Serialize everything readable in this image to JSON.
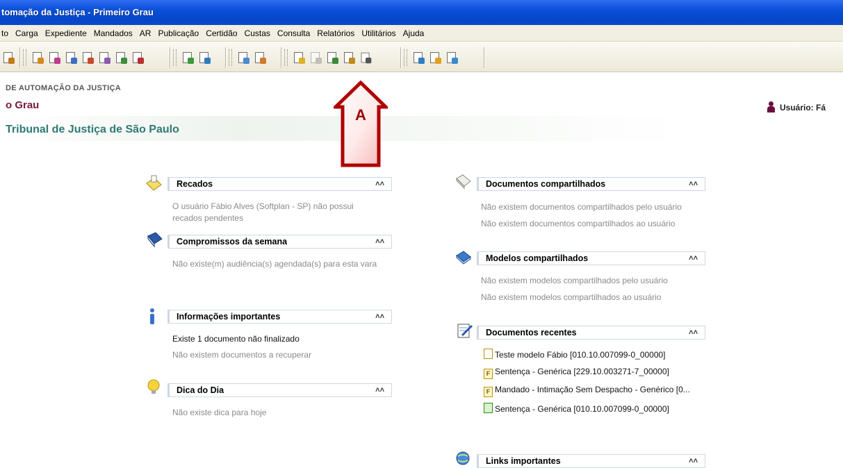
{
  "window": {
    "title": "tomação da Justiça - Primeiro Grau"
  },
  "menu": [
    "to",
    "Carga",
    "Expediente",
    "Mandados",
    "AR",
    "Publicação",
    "Certidão",
    "Custas",
    "Consulta",
    "Relatórios",
    "Utilitários",
    "Ajuda"
  ],
  "header": {
    "line1": "DE AUTOMAÇÃO DA JUSTIÇA",
    "line2": "o Grau",
    "line3": "Tribunal de Justiça de São Paulo",
    "user_label": "Usuário: Fá"
  },
  "marker": {
    "label": "A",
    "color": "#b00000"
  },
  "panels": {
    "recados": {
      "title": "Recados",
      "text": "O usuário Fábio Alves (Softplan - SP) não possui recados pendentes"
    },
    "compromissos": {
      "title": "Compromissos da semana",
      "text": "Não existe(m) audiência(s) agendada(s) para esta vara"
    },
    "informacoes": {
      "title": "Informações importantes",
      "text1": "Existe 1 documento não finalizado",
      "text2": "Não existem documentos a recuperar"
    },
    "dica": {
      "title": "Dica do Dia",
      "text": "Não existe dica para hoje"
    },
    "docs_compartilhados": {
      "title": "Documentos compartilhados",
      "text1": "Não existem documentos compartilhados pelo usuário",
      "text2": "Não existem documentos compartilhados ao usuário"
    },
    "modelos": {
      "title": "Modelos compartilhados",
      "text1": "Não existem modelos compartilhados pelo usuário",
      "text2": "Não existem modelos compartilhados ao usuário"
    },
    "recentes": {
      "title": "Documentos recentes",
      "items": [
        {
          "icon": "",
          "label": "Teste modelo Fábio [010.10.007099-0_00000]"
        },
        {
          "icon": "F",
          "label": "Sentença - Genérica [229.10.003271-7_00000]"
        },
        {
          "icon": "F",
          "label": "Mandado - Intimação Sem Despacho - Genérico [0..."
        },
        {
          "icon": "",
          "label": "Sentença - Genérica [010.10.007099-0_00000]"
        }
      ]
    },
    "links": {
      "title": "Links importantes"
    }
  },
  "colors": {
    "title_bar": "#0a4fd8",
    "accent_header": "#7a1a3a",
    "court_name": "#2f7a73"
  }
}
